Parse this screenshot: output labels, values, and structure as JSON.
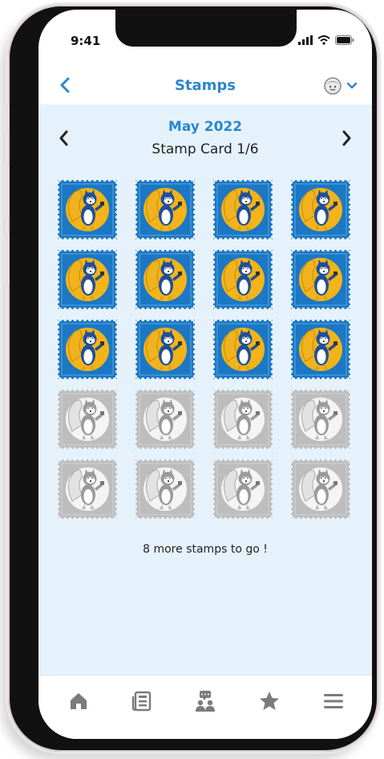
{
  "status_bar": {
    "time": "9:41"
  },
  "header": {
    "title": "Stamps",
    "back_icon": "chevron-left-icon",
    "profile_icon": "avatar-face-icon",
    "menu_icon": "chevron-down-icon"
  },
  "stamp_card": {
    "month": "May 2022",
    "card_label": "Stamp Card 1/6",
    "collected": 12,
    "total": 20,
    "remaining_message": "8 more stamps to go !"
  },
  "tabs": [
    {
      "name": "home",
      "icon": "home-icon"
    },
    {
      "name": "news",
      "icon": "newspaper-icon"
    },
    {
      "name": "community",
      "icon": "people-chat-icon"
    },
    {
      "name": "favorites",
      "icon": "star-icon"
    },
    {
      "name": "menu",
      "icon": "hamburger-menu-icon"
    }
  ],
  "colors": {
    "accent": "#2b86cf",
    "content_bg": "#e6f2fb",
    "stamp_active_bg": "#1c78c4",
    "stamp_active_moon": "#f2b418",
    "stamp_inactive_bg": "#bdbdbd",
    "tab_icon": "#7b7b7b"
  }
}
